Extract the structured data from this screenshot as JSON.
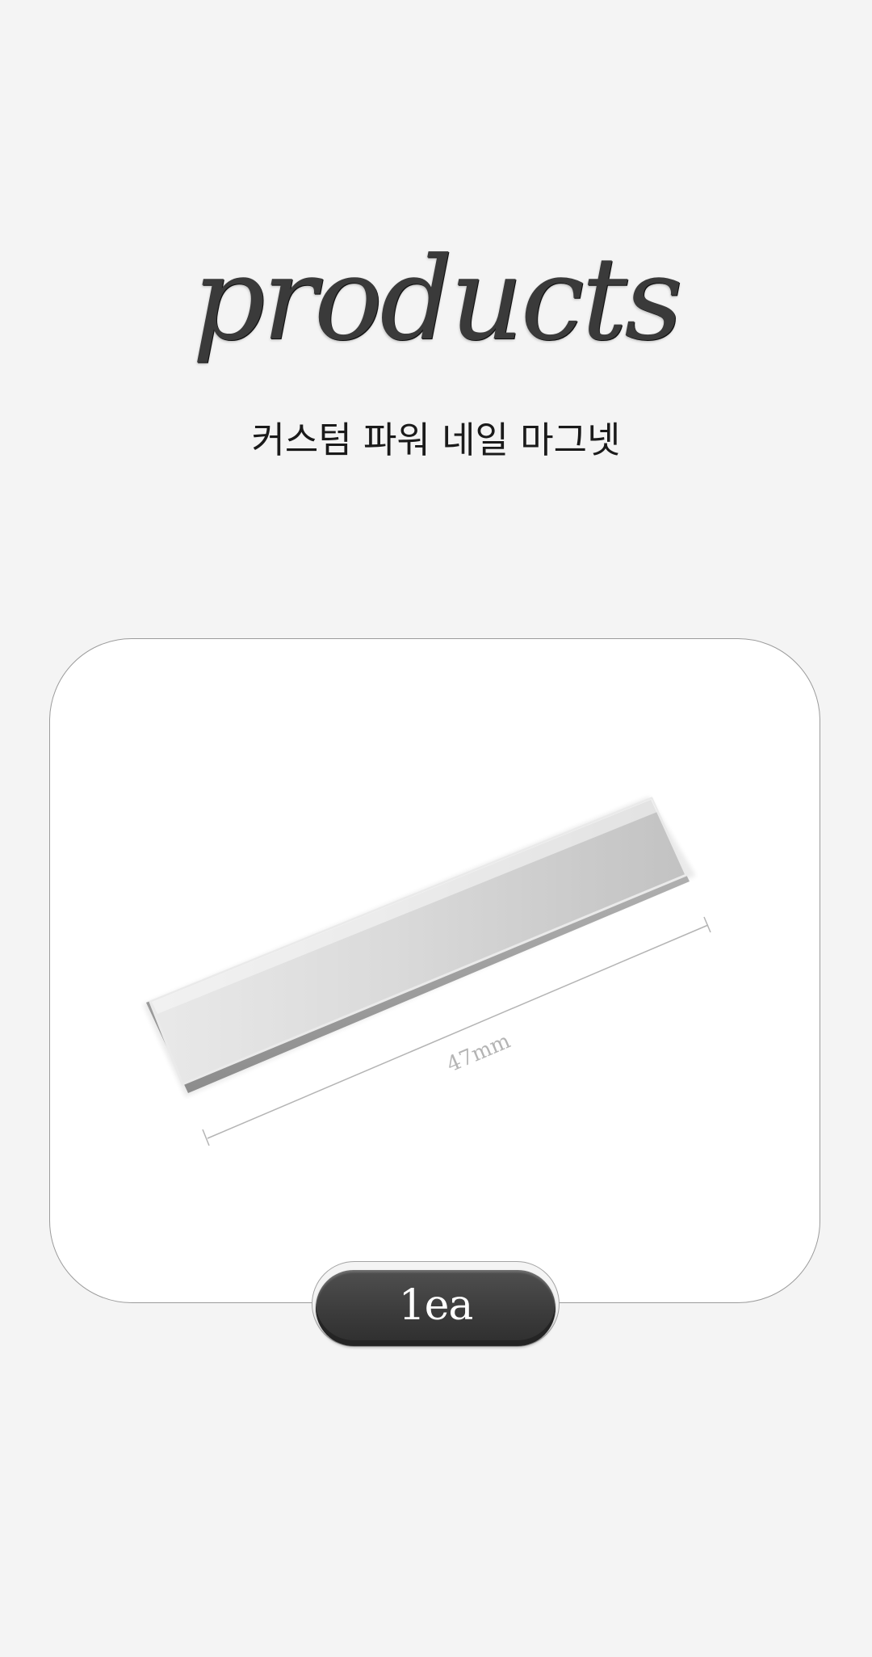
{
  "hero": {
    "title": "products",
    "subtitle": "커스텀 파워 네일 마그넷"
  },
  "product": {
    "dimension_label": "47mm",
    "quantity_label": "1ea"
  }
}
